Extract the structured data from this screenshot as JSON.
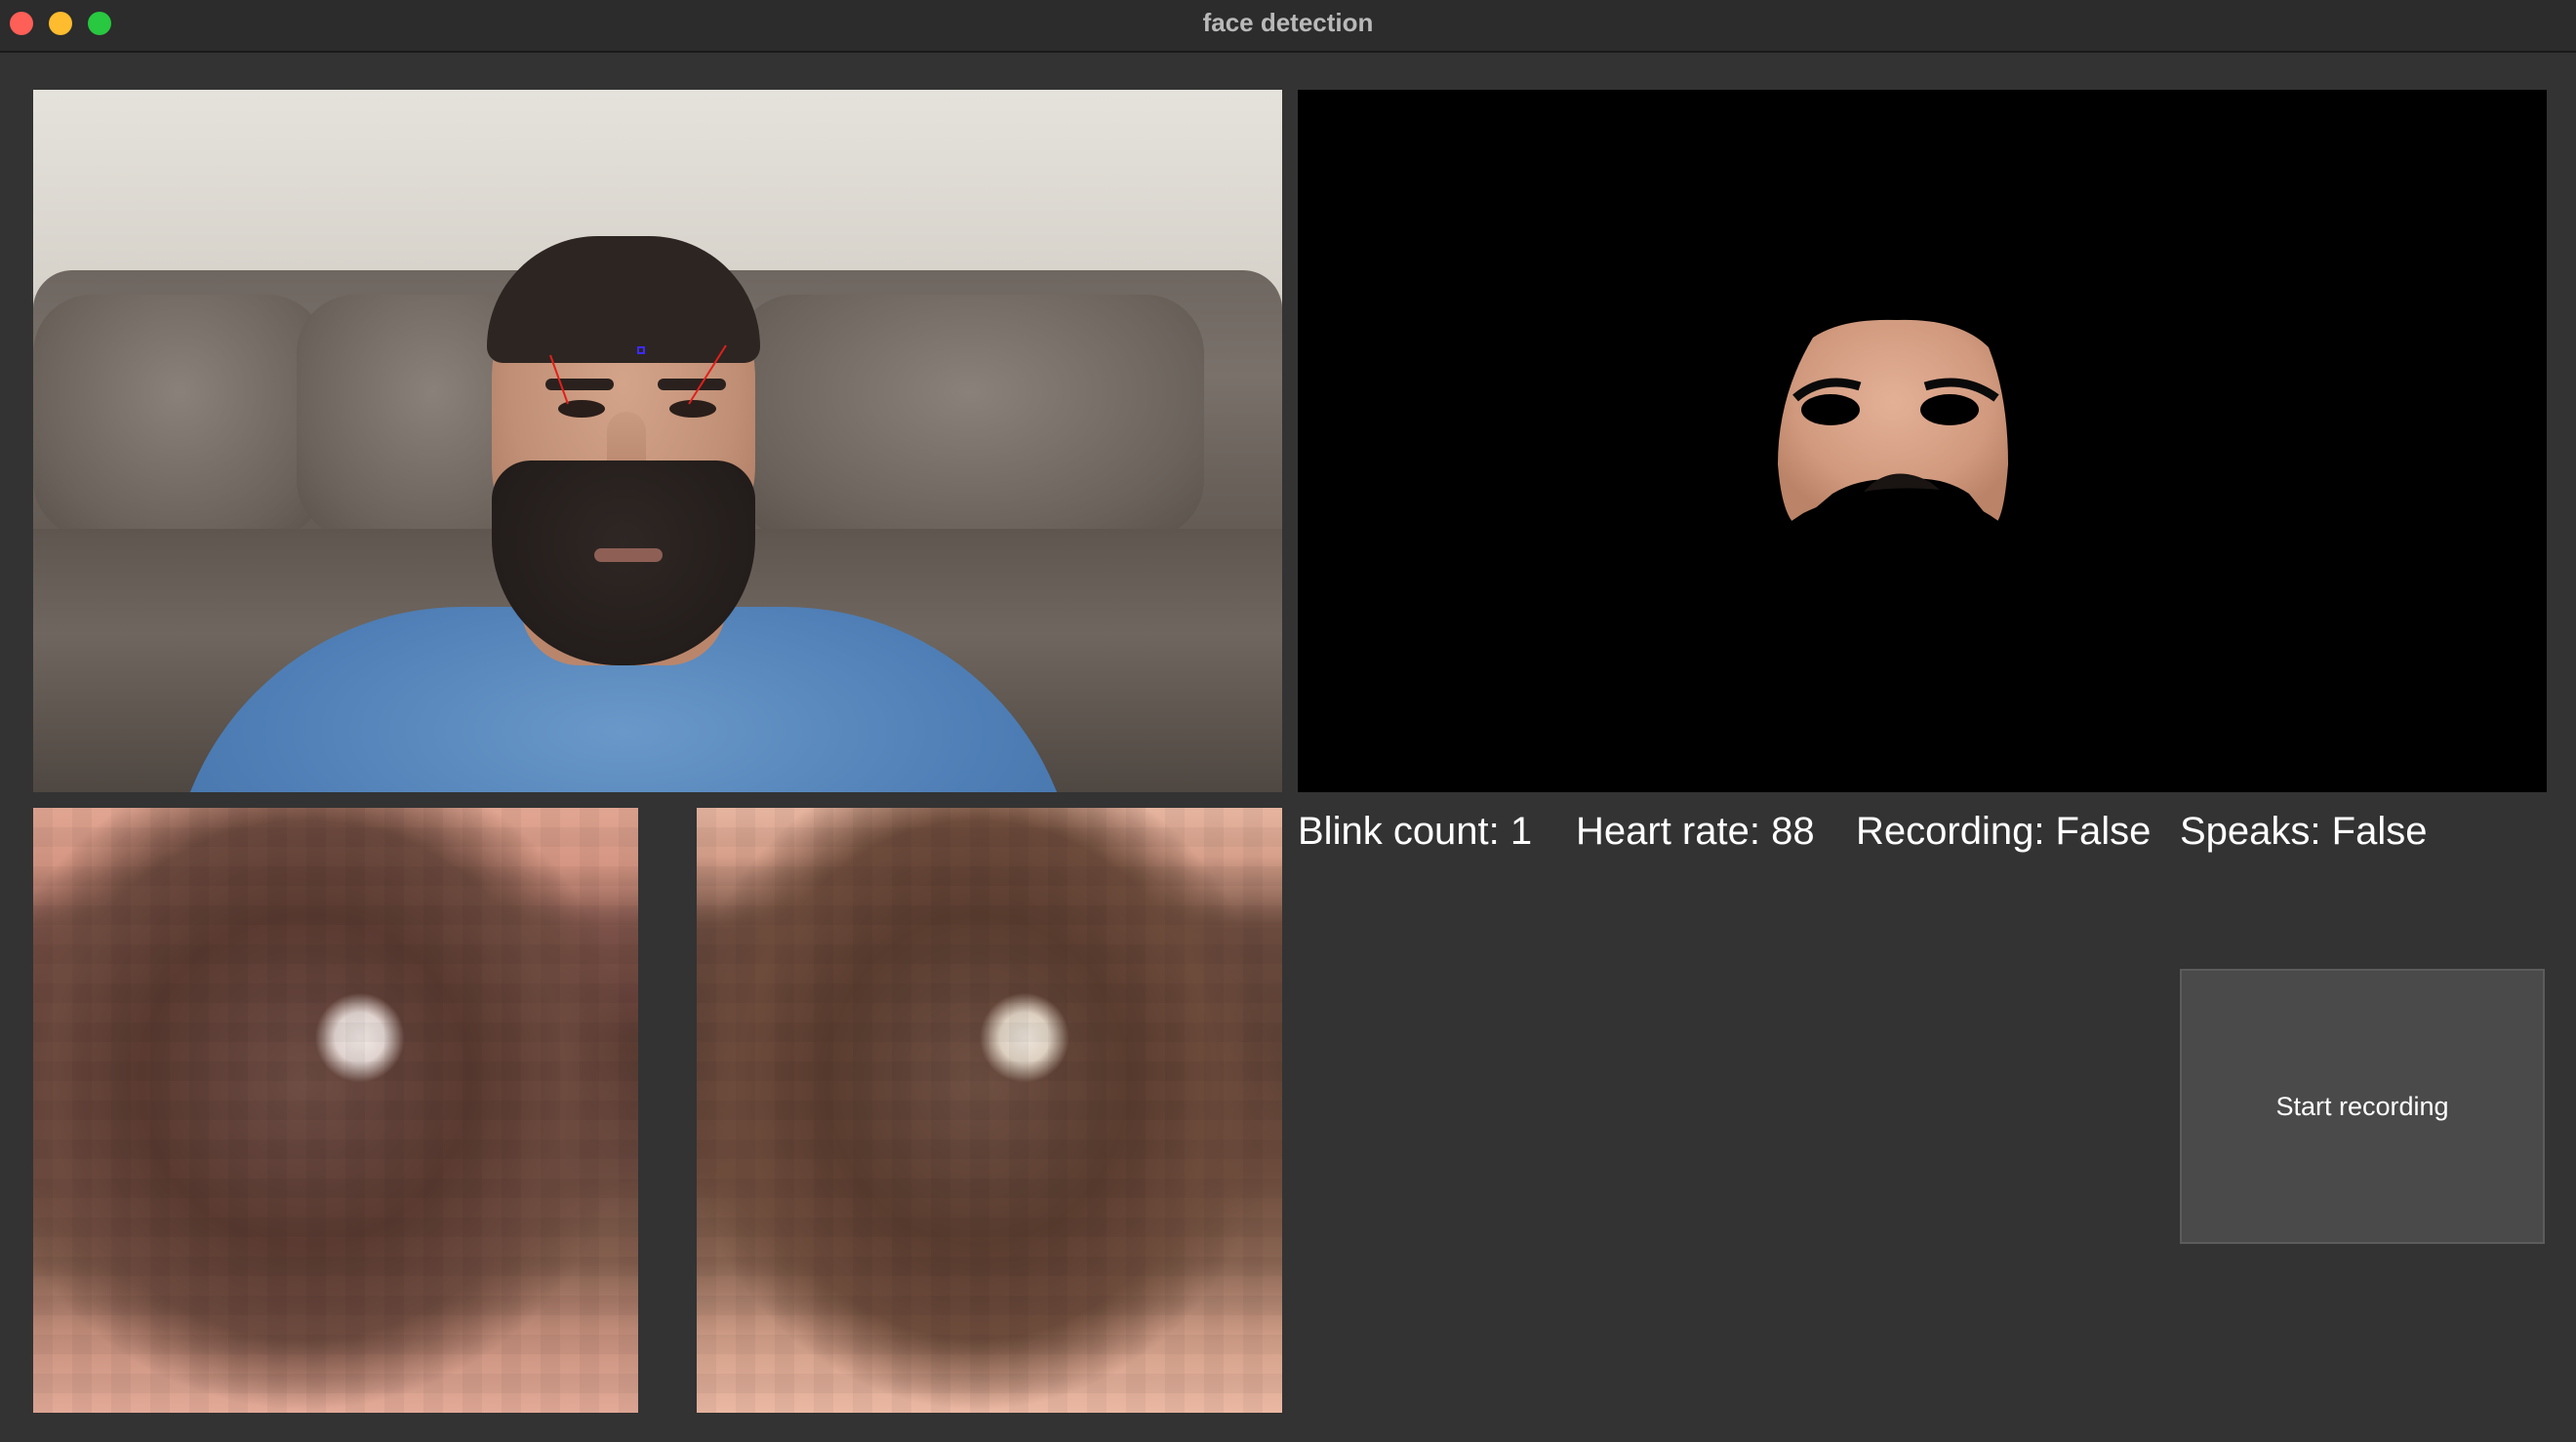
{
  "window": {
    "title": "face detection"
  },
  "stats": {
    "blink": "Blink count: 1",
    "heart": "Heart rate: 88",
    "recording": "Recording: False",
    "speaks": "Speaks: False"
  },
  "controls": {
    "start_recording_label": "Start recording"
  },
  "colors": {
    "window_bg": "#333333",
    "mask_bg": "#000000",
    "button_bg": "#4a4a4a",
    "landmark_line": "#e0201c",
    "landmark_point": "#3b2bff"
  },
  "icons": {
    "close": "red-close-dot",
    "minimize": "yellow-minimize-dot",
    "maximize": "green-zoom-dot"
  }
}
